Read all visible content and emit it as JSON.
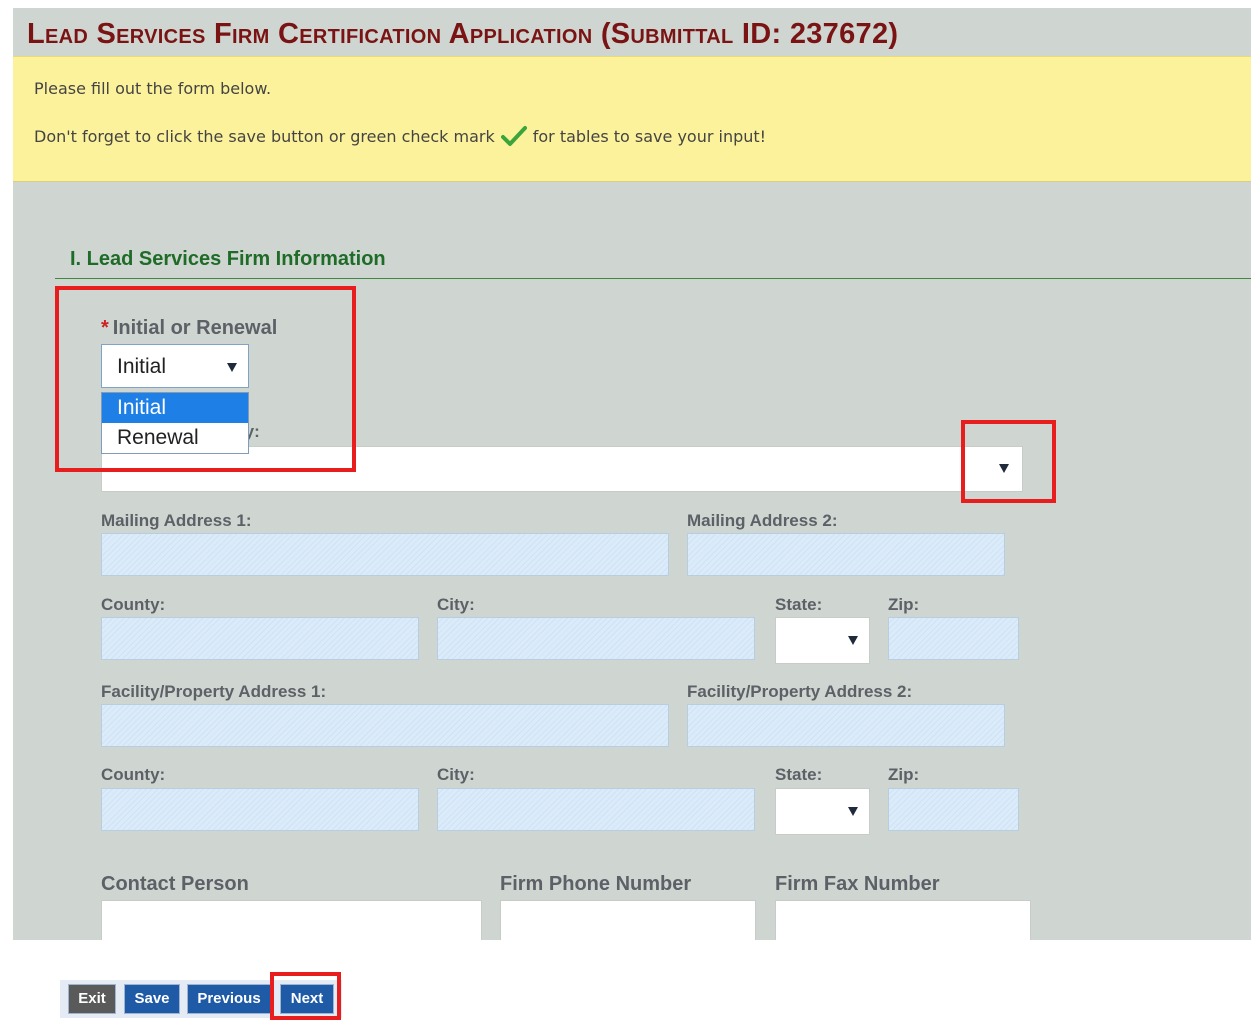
{
  "page_title": "Lead Services Firm Certification Application (Submittal ID: 237672)",
  "notice": {
    "line1": "Please fill out the form below.",
    "line2_before": "Don't forget to click the save button or green check mark",
    "line2_after": "for tables to save your input!",
    "check_icon": "green-check-icon"
  },
  "section": {
    "title": "I. Lead Services Firm Information"
  },
  "initial_or_renewal": {
    "label": "Initial or Renewal",
    "selected": "Initial",
    "options": [
      "Initial",
      "Renewal"
    ]
  },
  "partial_label_text": "ty:",
  "mailing": {
    "address1_label": "Mailing Address 1:",
    "address2_label": "Mailing Address 2:",
    "county_label": "County:",
    "city_label": "City:",
    "state_label": "State:",
    "zip_label": "Zip:"
  },
  "facility": {
    "address1_label": "Facility/Property Address 1:",
    "address2_label": "Facility/Property Address 2:",
    "county_label": "County:",
    "city_label": "City:",
    "state_label": "State:",
    "zip_label": "Zip:"
  },
  "contact": {
    "person_label": "Contact Person",
    "phone_label": "Firm Phone Number",
    "fax_label": "Firm Fax Number"
  },
  "buttons": {
    "exit": "Exit",
    "save": "Save",
    "previous": "Previous",
    "next": "Next"
  },
  "colors": {
    "title": "#7a1313",
    "section": "#1f6b28",
    "notice_bg": "#fcf29b",
    "highlight": "#e81e1e",
    "button_blue": "#1f5aa6",
    "button_gray": "#5a5a5a"
  }
}
